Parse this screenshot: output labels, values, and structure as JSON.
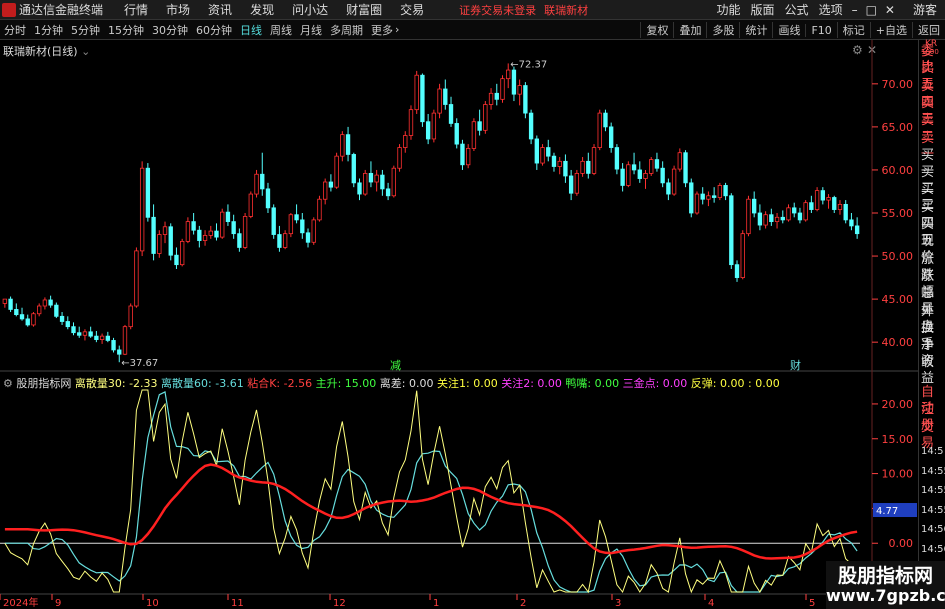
{
  "app": {
    "title": "通达信金融终端"
  },
  "menu": [
    "行情",
    "市场",
    "资讯",
    "发现",
    "问小达",
    "财富圈",
    "交易"
  ],
  "warning": "证券交易未登录",
  "stock_name": "联瑞新材",
  "right_menu": [
    "功能",
    "版面",
    "公式",
    "选项"
  ],
  "guest": "游客",
  "periods": [
    "分时",
    "1分钟",
    "5分钟",
    "15分钟",
    "30分钟",
    "60分钟",
    "日线",
    "周线",
    "月线",
    "多周期",
    "更多"
  ],
  "more_chevron": "›",
  "toolbar": [
    "复权",
    "叠加",
    "多股",
    "统计",
    "画线",
    "F10",
    "标记",
    "+自选",
    "返回"
  ],
  "main_panel": {
    "title": "联瑞新材(日线)",
    "max_label": "72.37",
    "min_label": "37.67",
    "marker_reduce": "减",
    "marker_fin": "财"
  },
  "price_axis": [
    "70.00",
    "65.00",
    "60.00",
    "55.00",
    "50.00",
    "45.00",
    "40.00"
  ],
  "ind_axis": [
    "20.00",
    "15.00",
    "10.00",
    "5.00",
    "0.00",
    "-5.00"
  ],
  "ind_current": "4.77",
  "indicator": {
    "name": "股朋指标网",
    "items": [
      {
        "label": "离散量30: -2.33",
        "color": "#ffff80"
      },
      {
        "label": "离散量60: -3.61",
        "color": "#66dddd"
      },
      {
        "label": "粘合K: -2.56",
        "color": "#ff4040"
      },
      {
        "label": "主升: 15.00",
        "color": "#40ff40"
      },
      {
        "label": "离差: 0.00",
        "color": "#dddddd"
      },
      {
        "label": "关注1: 0.00",
        "color": "#ffff40"
      },
      {
        "label": "关注2: 0.00",
        "color": "#ff40ff"
      },
      {
        "label": "鸭嘴: 0.00",
        "color": "#40ff40"
      },
      {
        "label": "三金点: 0.00",
        "color": "#ff40ff"
      },
      {
        "label": "反弹: 0.00 : 0.00",
        "color": "#ffff40"
      }
    ]
  },
  "date_axis": [
    "2024年",
    "9",
    "10",
    "11",
    "12",
    "1",
    "2",
    "3",
    "4",
    "5"
  ],
  "sidebar_top": [
    "KR",
    "1000"
  ],
  "sidebar": [
    "委比",
    "卖五",
    "卖四",
    "卖三",
    "卖二",
    "卖一",
    "买一",
    "买二",
    "买三",
    "买四",
    "买五",
    "现价",
    "涨跌",
    "涨幅",
    "总量",
    "外盘",
    "换手",
    "净资",
    "收益",
    "自动",
    "注册",
    "交易"
  ],
  "sidebar_times": [
    "14:5",
    "14:55",
    "14:55",
    "14:55",
    "14:56",
    "14:56",
    "14:56",
    "14:56"
  ],
  "watermark": {
    "line1": "股朋指标网",
    "line2": "www.7gpzb.com"
  },
  "colors": {
    "up": "#ff3030",
    "down": "#54ffff",
    "bg": "#000000",
    "warn": "#ff4040",
    "active": "#55dddd"
  },
  "chart_data": {
    "type": "candlestick",
    "title": "联瑞新材(日线)",
    "price_range": [
      37.67,
      72.37
    ],
    "ylim": [
      37,
      73
    ],
    "indicator_ylim": [
      -7,
      22
    ],
    "x_months": [
      "2024年",
      "9",
      "10",
      "11",
      "12",
      "1",
      "2",
      "3",
      "4",
      "5"
    ],
    "candles": [
      [
        44.5,
        45.0,
        44.0,
        45.0
      ],
      [
        45.0,
        45.3,
        43.5,
        43.8
      ],
      [
        43.8,
        44.5,
        43.0,
        43.2
      ],
      [
        43.2,
        44.0,
        42.5,
        42.7
      ],
      [
        42.7,
        43.2,
        41.8,
        42.0
      ],
      [
        42.0,
        43.5,
        41.8,
        43.3
      ],
      [
        43.3,
        44.5,
        43.0,
        44.2
      ],
      [
        44.2,
        45.2,
        43.8,
        44.9
      ],
      [
        44.9,
        45.4,
        44.0,
        44.3
      ],
      [
        44.3,
        44.6,
        42.8,
        43.0
      ],
      [
        43.0,
        43.5,
        42.0,
        42.4
      ],
      [
        42.4,
        43.0,
        41.5,
        41.8
      ],
      [
        41.8,
        42.3,
        40.8,
        41.1
      ],
      [
        41.1,
        41.8,
        40.5,
        40.8
      ],
      [
        40.8,
        41.5,
        40.2,
        41.2
      ],
      [
        41.2,
        41.8,
        40.5,
        40.7
      ],
      [
        40.7,
        41.3,
        40.0,
        40.3
      ],
      [
        40.3,
        41.0,
        39.8,
        40.7
      ],
      [
        40.7,
        41.2,
        40.0,
        40.2
      ],
      [
        40.2,
        40.5,
        38.8,
        39.1
      ],
      [
        39.1,
        39.6,
        37.67,
        38.6
      ],
      [
        38.6,
        42.0,
        38.5,
        41.8
      ],
      [
        41.8,
        44.5,
        41.5,
        44.2
      ],
      [
        44.2,
        51.0,
        44.0,
        50.6
      ],
      [
        50.6,
        61.0,
        50.0,
        60.2
      ],
      [
        60.2,
        60.8,
        54.0,
        54.5
      ],
      [
        54.5,
        56.0,
        49.5,
        50.3
      ],
      [
        50.3,
        53.0,
        49.8,
        52.5
      ],
      [
        52.5,
        54.0,
        51.5,
        53.4
      ],
      [
        53.4,
        53.8,
        49.5,
        50.1
      ],
      [
        50.1,
        51.0,
        48.5,
        49.0
      ],
      [
        49.0,
        52.0,
        48.8,
        51.7
      ],
      [
        51.7,
        54.5,
        51.5,
        54.0
      ],
      [
        54.0,
        55.0,
        52.5,
        53.0
      ],
      [
        53.0,
        53.5,
        51.0,
        51.8
      ],
      [
        51.8,
        53.0,
        51.2,
        52.4
      ],
      [
        52.4,
        53.5,
        52.0,
        52.9
      ],
      [
        52.9,
        53.8,
        51.8,
        52.2
      ],
      [
        52.2,
        55.5,
        52.0,
        55.1
      ],
      [
        55.1,
        56.0,
        53.5,
        54.0
      ],
      [
        54.0,
        54.8,
        52.0,
        52.6
      ],
      [
        52.6,
        53.2,
        50.5,
        51.0
      ],
      [
        51.0,
        55.0,
        50.8,
        54.6
      ],
      [
        54.6,
        57.5,
        54.4,
        57.2
      ],
      [
        57.2,
        60.0,
        56.8,
        59.5
      ],
      [
        59.5,
        62.0,
        57.0,
        57.8
      ],
      [
        57.8,
        58.5,
        55.0,
        55.6
      ],
      [
        55.6,
        56.0,
        52.0,
        52.5
      ],
      [
        52.5,
        53.5,
        50.5,
        51.0
      ],
      [
        51.0,
        53.0,
        50.8,
        52.6
      ],
      [
        52.6,
        55.0,
        52.2,
        54.8
      ],
      [
        54.8,
        56.0,
        53.8,
        54.2
      ],
      [
        54.2,
        55.0,
        52.0,
        52.7
      ],
      [
        52.7,
        53.2,
        51.0,
        51.6
      ],
      [
        51.6,
        54.5,
        51.3,
        54.2
      ],
      [
        54.2,
        57.0,
        54.0,
        56.6
      ],
      [
        56.6,
        59.0,
        56.0,
        58.6
      ],
      [
        58.6,
        59.5,
        57.5,
        58.0
      ],
      [
        58.0,
        62.0,
        57.8,
        61.6
      ],
      [
        61.6,
        64.5,
        61.0,
        64.1
      ],
      [
        64.1,
        65.0,
        61.0,
        61.8
      ],
      [
        61.8,
        62.0,
        58.0,
        58.5
      ],
      [
        58.5,
        59.0,
        56.5,
        57.2
      ],
      [
        57.2,
        60.0,
        57.0,
        59.6
      ],
      [
        59.6,
        61.0,
        58.0,
        58.6
      ],
      [
        58.6,
        60.0,
        57.5,
        59.4
      ],
      [
        59.4,
        60.0,
        57.0,
        57.8
      ],
      [
        57.8,
        58.5,
        56.5,
        57.0
      ],
      [
        57.0,
        60.5,
        56.8,
        60.2
      ],
      [
        60.2,
        63.0,
        59.8,
        62.6
      ],
      [
        62.6,
        64.5,
        62.0,
        64.0
      ],
      [
        64.0,
        67.5,
        63.5,
        67.0
      ],
      [
        67.0,
        71.5,
        66.5,
        71.0
      ],
      [
        71.0,
        71.2,
        65.0,
        65.6
      ],
      [
        65.6,
        66.5,
        63.0,
        63.6
      ],
      [
        63.6,
        67.0,
        63.2,
        66.6
      ],
      [
        66.6,
        70.0,
        66.0,
        69.4
      ],
      [
        69.4,
        70.5,
        67.0,
        67.6
      ],
      [
        67.6,
        68.5,
        65.0,
        65.4
      ],
      [
        65.4,
        66.0,
        62.5,
        63.0
      ],
      [
        63.0,
        63.5,
        60.0,
        60.6
      ],
      [
        60.6,
        63.0,
        60.2,
        62.5
      ],
      [
        62.5,
        66.0,
        62.2,
        65.6
      ],
      [
        65.6,
        67.0,
        64.0,
        64.6
      ],
      [
        64.6,
        68.0,
        64.2,
        67.6
      ],
      [
        67.6,
        69.5,
        67.0,
        68.9
      ],
      [
        68.9,
        70.0,
        67.5,
        68.2
      ],
      [
        68.2,
        71.0,
        67.8,
        70.6
      ],
      [
        70.6,
        72.37,
        69.5,
        71.6
      ],
      [
        71.6,
        72.0,
        68.0,
        68.8
      ],
      [
        68.8,
        70.5,
        67.5,
        69.8
      ],
      [
        69.8,
        70.2,
        66.0,
        66.6
      ],
      [
        66.6,
        67.0,
        63.0,
        63.6
      ],
      [
        63.6,
        64.0,
        60.0,
        60.8
      ],
      [
        60.8,
        63.0,
        60.5,
        62.6
      ],
      [
        62.6,
        63.5,
        61.0,
        61.6
      ],
      [
        61.6,
        62.0,
        59.8,
        60.4
      ],
      [
        60.4,
        61.5,
        59.5,
        61.0
      ],
      [
        61.0,
        61.8,
        58.5,
        59.3
      ],
      [
        59.3,
        60.0,
        56.5,
        57.3
      ],
      [
        57.3,
        60.0,
        57.0,
        59.6
      ],
      [
        59.6,
        61.5,
        59.2,
        61.0
      ],
      [
        61.0,
        62.0,
        59.0,
        59.6
      ],
      [
        59.6,
        63.0,
        59.4,
        62.6
      ],
      [
        62.6,
        67.0,
        62.3,
        66.6
      ],
      [
        66.6,
        67.0,
        64.5,
        65.0
      ],
      [
        65.0,
        65.5,
        62.0,
        62.6
      ],
      [
        62.6,
        63.0,
        59.5,
        60.1
      ],
      [
        60.1,
        60.8,
        57.5,
        58.2
      ],
      [
        58.2,
        61.0,
        58.0,
        60.6
      ],
      [
        60.6,
        62.0,
        59.5,
        60.0
      ],
      [
        60.0,
        61.0,
        58.5,
        59.0
      ],
      [
        59.0,
        60.0,
        57.8,
        59.6
      ],
      [
        59.6,
        61.5,
        59.3,
        61.2
      ],
      [
        61.2,
        62.0,
        59.8,
        60.2
      ],
      [
        60.2,
        61.0,
        58.0,
        58.5
      ],
      [
        58.5,
        59.0,
        56.5,
        57.2
      ],
      [
        57.2,
        60.5,
        57.0,
        60.1
      ],
      [
        60.1,
        62.5,
        59.8,
        62.0
      ],
      [
        62.0,
        62.3,
        58.0,
        58.5
      ],
      [
        58.5,
        59.0,
        54.5,
        55.0
      ],
      [
        55.0,
        57.5,
        54.8,
        57.2
      ],
      [
        57.2,
        58.0,
        56.0,
        56.6
      ],
      [
        56.6,
        57.5,
        55.8,
        57.0
      ],
      [
        57.0,
        58.0,
        56.2,
        56.8
      ],
      [
        56.8,
        58.5,
        56.5,
        58.2
      ],
      [
        58.2,
        58.5,
        56.5,
        57.0
      ],
      [
        57.0,
        57.3,
        48.5,
        49.0
      ],
      [
        49.0,
        49.5,
        47.0,
        47.5
      ],
      [
        47.5,
        53.0,
        47.3,
        52.6
      ],
      [
        52.6,
        57.0,
        52.3,
        56.6
      ],
      [
        56.6,
        57.5,
        54.5,
        55.0
      ],
      [
        55.0,
        56.0,
        53.0,
        53.6
      ],
      [
        53.6,
        55.2,
        53.2,
        54.8
      ],
      [
        54.8,
        55.5,
        53.5,
        54.0
      ],
      [
        54.0,
        55.0,
        53.2,
        54.5
      ],
      [
        54.5,
        55.3,
        53.8,
        54.2
      ],
      [
        54.2,
        56.0,
        54.0,
        55.6
      ],
      [
        55.6,
        56.2,
        54.5,
        55.0
      ],
      [
        55.0,
        55.6,
        53.8,
        54.2
      ],
      [
        54.2,
        56.5,
        54.0,
        56.2
      ],
      [
        56.2,
        57.0,
        55.0,
        55.4
      ],
      [
        55.4,
        58.0,
        55.2,
        57.6
      ],
      [
        57.6,
        58.0,
        56.0,
        56.5
      ],
      [
        56.5,
        57.2,
        55.5,
        56.8
      ],
      [
        56.8,
        57.0,
        55.0,
        55.4
      ],
      [
        55.4,
        56.5,
        54.8,
        56.0
      ],
      [
        56.0,
        56.5,
        53.8,
        54.2
      ],
      [
        54.2,
        55.0,
        53.0,
        53.5
      ],
      [
        53.5,
        54.5,
        52.0,
        52.6
      ]
    ]
  }
}
